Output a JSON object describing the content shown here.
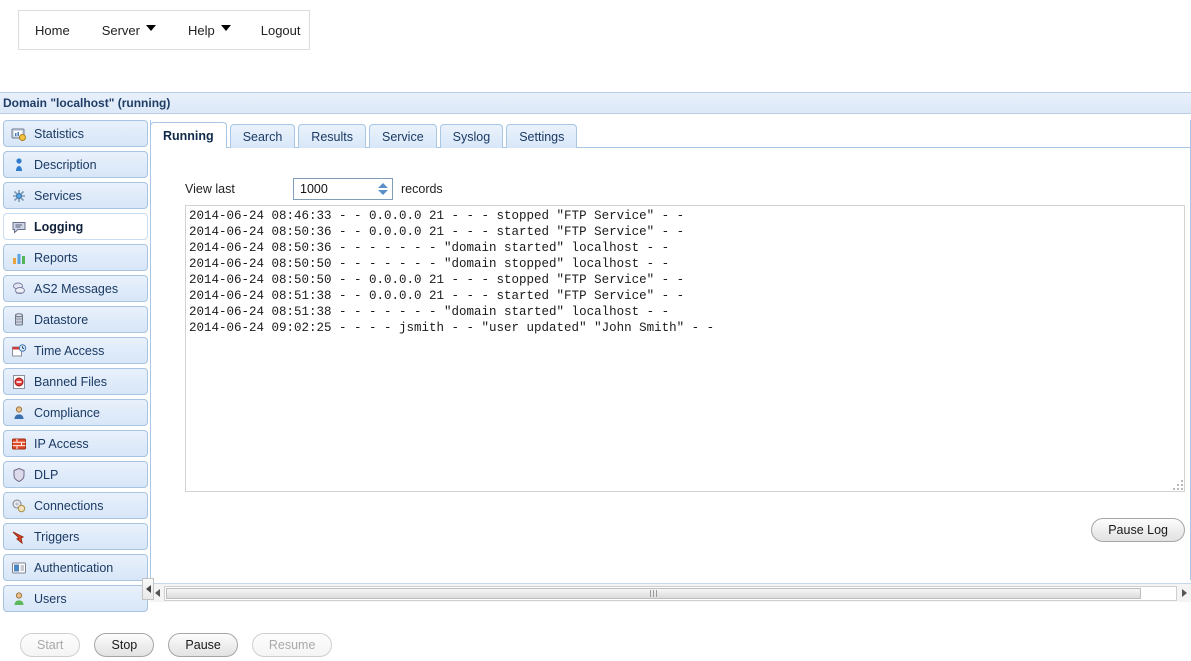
{
  "menubar": {
    "items": [
      {
        "label": "Home",
        "icon": "",
        "has_caret": false
      },
      {
        "label": "Server",
        "icon": "chevron-down-icon",
        "has_caret": true
      },
      {
        "label": "Help",
        "icon": "chevron-down-icon",
        "has_caret": true
      },
      {
        "label": "Logout",
        "icon": "",
        "has_caret": false
      }
    ]
  },
  "domain_header": {
    "title": "Domain \"localhost\" (running)"
  },
  "sidebar": {
    "items": [
      {
        "label": "Statistics",
        "icon": "statistics-icon",
        "active": false
      },
      {
        "label": "Description",
        "icon": "description-icon",
        "active": false
      },
      {
        "label": "Services",
        "icon": "services-icon",
        "active": false
      },
      {
        "label": "Logging",
        "icon": "logging-icon",
        "active": true
      },
      {
        "label": "Reports",
        "icon": "reports-icon",
        "active": false
      },
      {
        "label": "AS2 Messages",
        "icon": "as2-messages-icon",
        "active": false
      },
      {
        "label": "Datastore",
        "icon": "datastore-icon",
        "active": false
      },
      {
        "label": "Time Access",
        "icon": "time-access-icon",
        "active": false
      },
      {
        "label": "Banned Files",
        "icon": "banned-files-icon",
        "active": false
      },
      {
        "label": "Compliance",
        "icon": "compliance-icon",
        "active": false
      },
      {
        "label": "IP Access",
        "icon": "ip-access-icon",
        "active": false
      },
      {
        "label": "DLP",
        "icon": "dlp-icon",
        "active": false
      },
      {
        "label": "Connections",
        "icon": "connections-icon",
        "active": false
      },
      {
        "label": "Triggers",
        "icon": "triggers-icon",
        "active": false
      },
      {
        "label": "Authentication",
        "icon": "authentication-icon",
        "active": false
      },
      {
        "label": "Users",
        "icon": "users-icon",
        "active": false
      }
    ]
  },
  "tabs": [
    {
      "label": "Running",
      "active": true
    },
    {
      "label": "Search",
      "active": false
    },
    {
      "label": "Results",
      "active": false
    },
    {
      "label": "Service",
      "active": false
    },
    {
      "label": "Syslog",
      "active": false
    },
    {
      "label": "Settings",
      "active": false
    }
  ],
  "running_tab": {
    "view_last_label": "View last",
    "records_count": "1000",
    "records_placeholder": "1000",
    "records_label": "records",
    "pause_log_button": "Pause Log",
    "log_lines": [
      "2014-06-24 08:46:33 - - 0.0.0.0 21 - - - stopped \"FTP Service\" - -",
      "2014-06-24 08:50:36 - - 0.0.0.0 21 - - - started \"FTP Service\" - -",
      "2014-06-24 08:50:36 - - - - - - - \"domain started\" localhost - -",
      "2014-06-24 08:50:50 - - - - - - - \"domain stopped\" localhost - -",
      "2014-06-24 08:50:50 - - 0.0.0.0 21 - - - stopped \"FTP Service\" - -",
      "2014-06-24 08:51:38 - - 0.0.0.0 21 - - - started \"FTP Service\" - -",
      "2014-06-24 08:51:38 - - - - - - - \"domain started\" localhost - -",
      "2014-06-24 09:02:25 - - - - jsmith - - \"user updated\" \"John Smith\" - -"
    ]
  },
  "bottom_toolbar": {
    "buttons": [
      {
        "label": "Start",
        "disabled": true
      },
      {
        "label": "Stop",
        "disabled": false
      },
      {
        "label": "Pause",
        "disabled": false
      },
      {
        "label": "Resume",
        "disabled": true
      }
    ]
  },
  "colors": {
    "header_blue": "#dce8f8",
    "header_text": "#1f3d66",
    "panel_border": "#a9c6e4",
    "sidebar_item": "#d7e6f8",
    "accent": "#5b8fc9"
  }
}
